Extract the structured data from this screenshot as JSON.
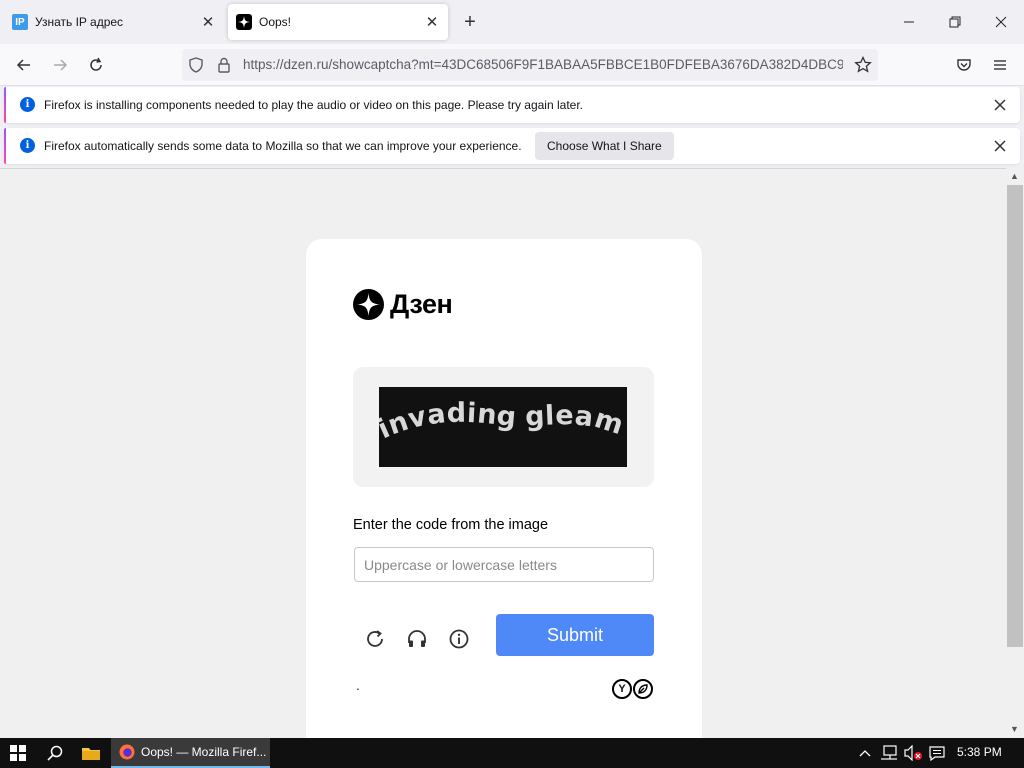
{
  "tabs": [
    {
      "title": "Узнать IP адрес",
      "favicon": "IP",
      "favicon_color": "#3d9be9",
      "active": false
    },
    {
      "title": "Oops!",
      "active": true
    }
  ],
  "navbar": {
    "url": "https://dzen.ru/showcaptcha?mt=43DC68506F9F1BABAA5FBBCE1B0FDFEBA3676DA382D4DBC9"
  },
  "notifications": [
    {
      "message": "Firefox is installing components needed to play the audio or video on this page. Please try again later."
    },
    {
      "message": "Firefox automatically sends some data to Mozilla so that we can improve your experience.",
      "button": "Choose What I Share"
    }
  ],
  "page": {
    "brand": "Дзен",
    "captcha_text": "invading gleaming",
    "prompt": "Enter the code from the image",
    "input_placeholder": "Uppercase or lowercase letters",
    "input_value": "",
    "submit_label": "Submit",
    "footer_dot": ".",
    "accent_color": "#4f88f7"
  },
  "taskbar": {
    "window_title": "Oops! — Mozilla Firef...",
    "time": "5:38 PM"
  }
}
